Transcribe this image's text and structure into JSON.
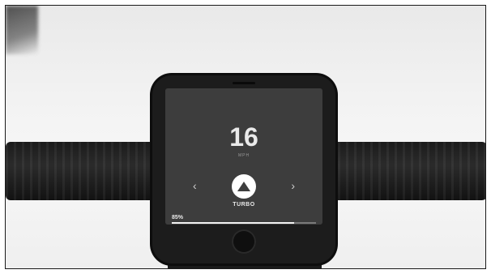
{
  "status_bar": {
    "carrier": "",
    "time": "",
    "battery": ""
  },
  "app_bar": {
    "left": "",
    "title": ""
  },
  "speed": {
    "value": "16",
    "unit": "MPH"
  },
  "assist_mode": {
    "label": "TURBO",
    "prev_icon": "chevron-left-icon",
    "next_icon": "chevron-right-icon",
    "mode_icon": "mode-icon"
  },
  "battery": {
    "caption": "",
    "value": "85%",
    "level": 0.85
  },
  "colors": {
    "screen_bg": "#3d3d3d",
    "accent": "#ffffff"
  }
}
